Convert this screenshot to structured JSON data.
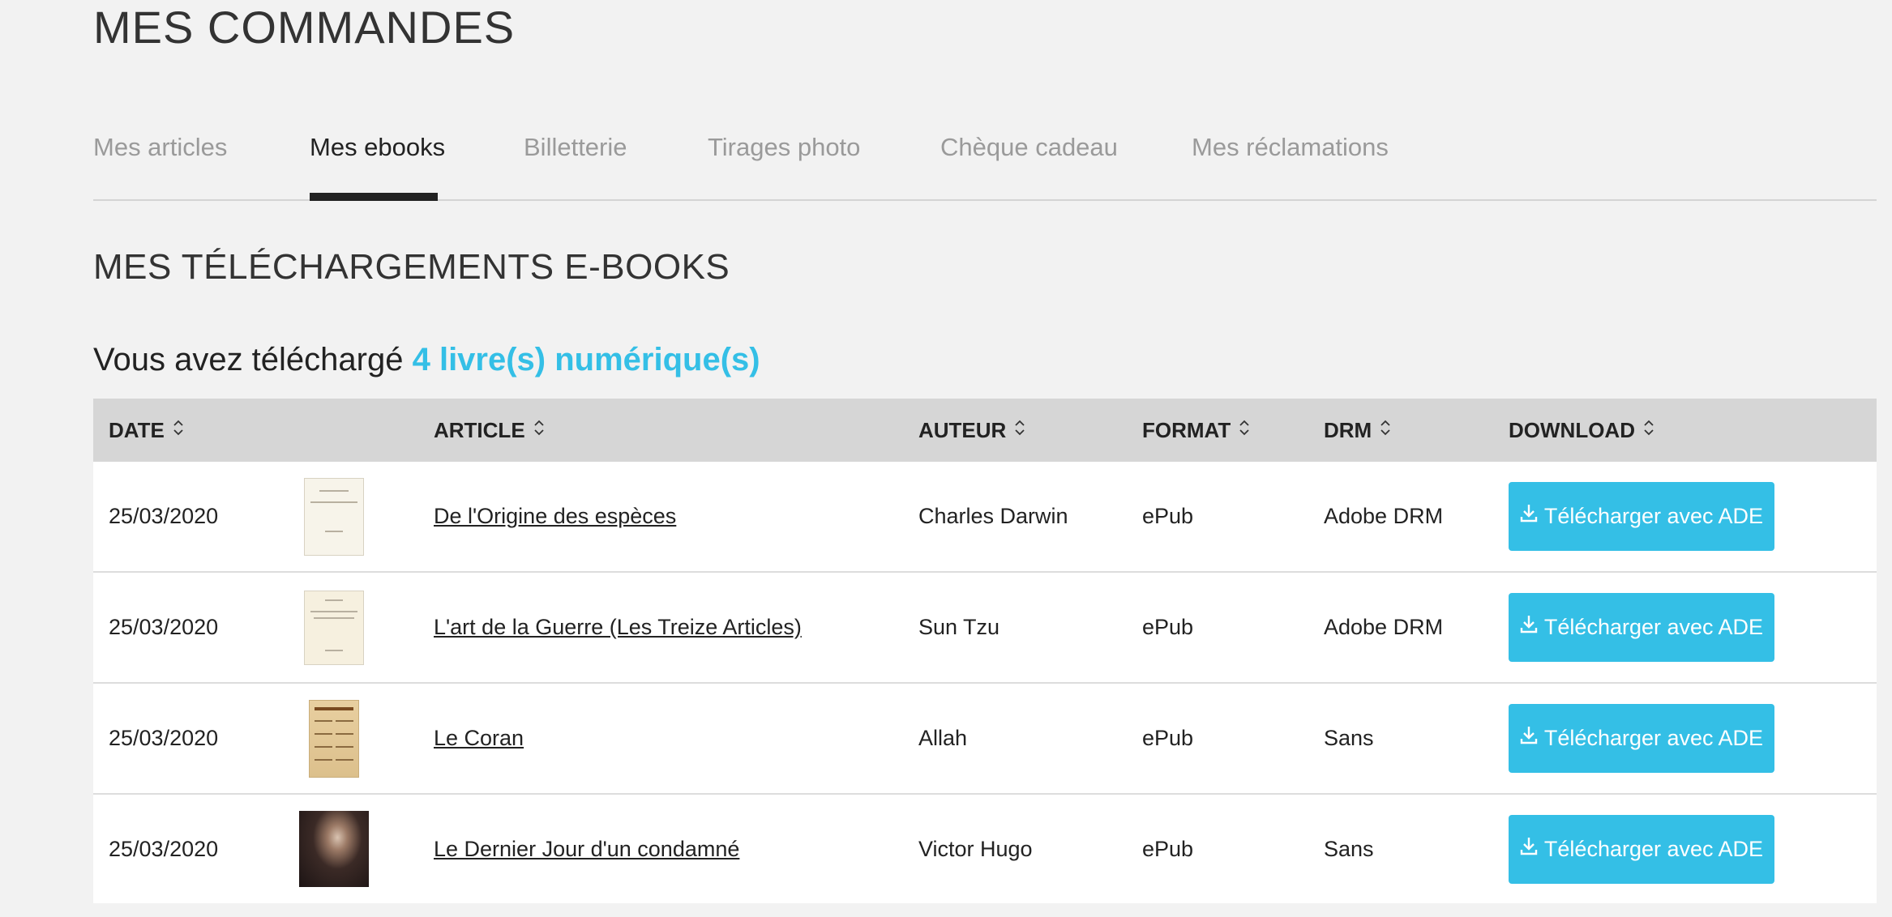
{
  "header": {
    "title": "MES COMMANDES"
  },
  "tabs": [
    {
      "label": "Mes articles",
      "active": false
    },
    {
      "label": "Mes ebooks",
      "active": true
    },
    {
      "label": "Billetterie",
      "active": false
    },
    {
      "label": "Tirages photo",
      "active": false
    },
    {
      "label": "Chèque cadeau",
      "active": false
    },
    {
      "label": "Mes réclamations",
      "active": false
    }
  ],
  "section": {
    "title": "MES TÉLÉCHARGEMENTS E-BOOKS",
    "summary_prefix": "Vous avez téléchargé ",
    "summary_count": "4 livre(s) numérique(s)"
  },
  "table": {
    "columns": [
      "DATE",
      "ARTICLE",
      "AUTEUR",
      "FORMAT",
      "DRM",
      "DOWNLOAD"
    ],
    "rows": [
      {
        "date": "25/03/2020",
        "cover_icon": "book-cover-origine-especes",
        "article": "De l'Origine des espèces",
        "auteur": "Charles Darwin",
        "format": "ePub",
        "drm": "Adobe DRM",
        "download_label": "Télécharger avec ADE"
      },
      {
        "date": "25/03/2020",
        "cover_icon": "book-cover-art-de-la-guerre",
        "article": "L'art de la Guerre (Les Treize Articles)",
        "auteur": "Sun Tzu",
        "format": "ePub",
        "drm": "Adobe DRM",
        "download_label": "Télécharger avec ADE"
      },
      {
        "date": "25/03/2020",
        "cover_icon": "book-cover-coran",
        "article": "Le Coran",
        "auteur": "Allah",
        "format": "ePub",
        "drm": "Sans",
        "download_label": "Télécharger avec ADE"
      },
      {
        "date": "25/03/2020",
        "cover_icon": "book-cover-dernier-jour",
        "article": "Le Dernier Jour d'un condamné",
        "auteur": "Victor Hugo",
        "format": "ePub",
        "drm": "Sans",
        "download_label": "Télécharger avec ADE"
      }
    ]
  },
  "colors": {
    "accent": "#34bfe6",
    "background": "#f2f2f2",
    "header_row": "#d6d6d6",
    "text": "#222222",
    "inactive_tab": "#9a9a9a"
  },
  "icons": {
    "sort": "sort-arrows-icon",
    "download": "download-icon"
  }
}
